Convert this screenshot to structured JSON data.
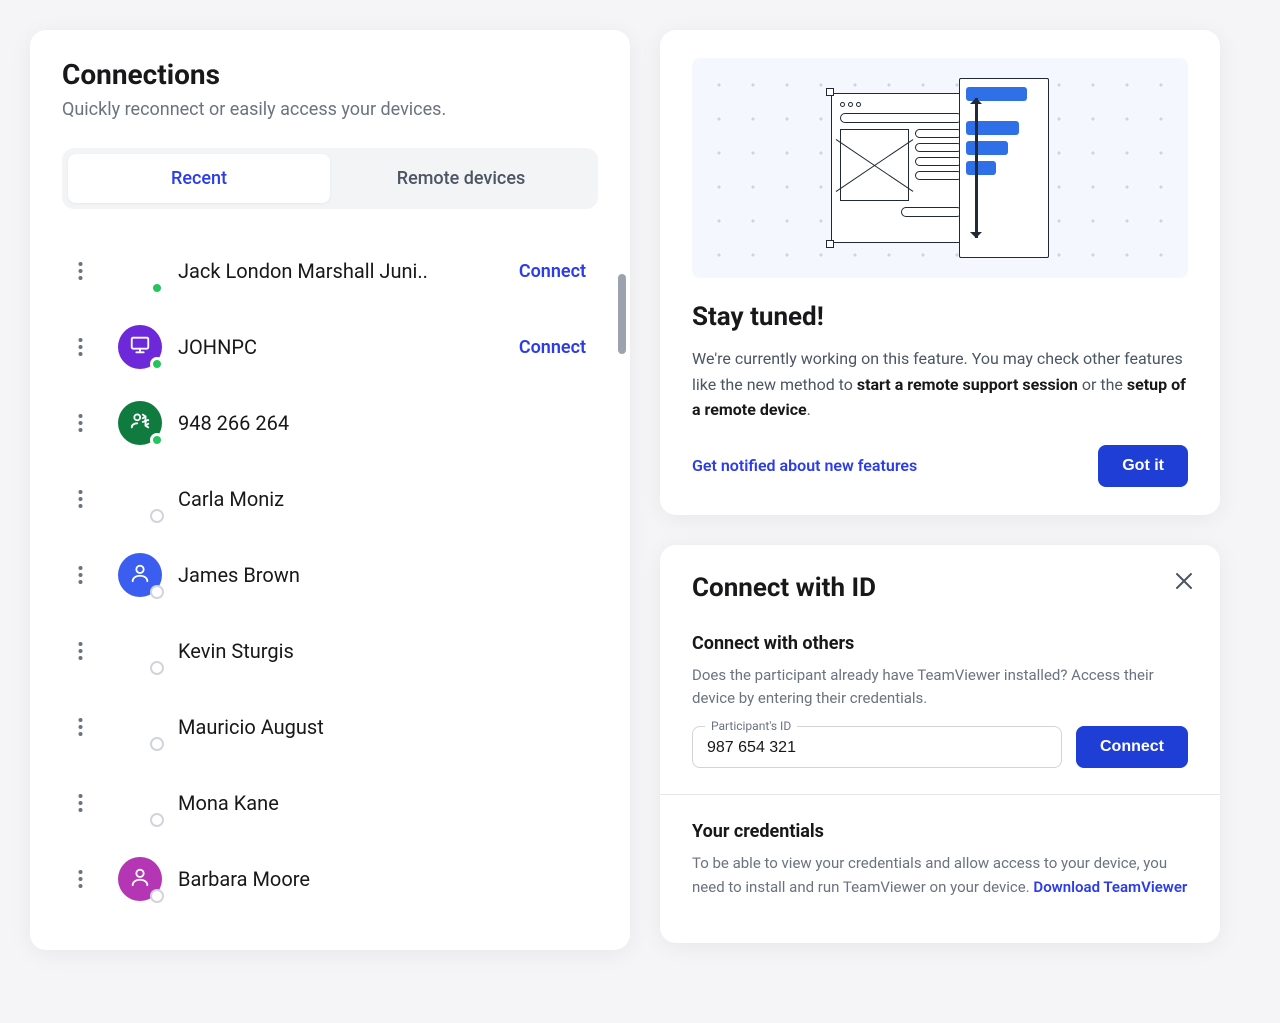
{
  "connections": {
    "title": "Connections",
    "subtitle": "Quickly reconnect or easily access your devices.",
    "tabs": {
      "recent": "Recent",
      "remote": "Remote devices"
    },
    "connect_label": "Connect",
    "items": [
      {
        "name": "Jack London Marshall Juni..",
        "avatar": "none",
        "status": "online",
        "show_connect": true
      },
      {
        "name": "JOHNPC",
        "avatar": "purple",
        "icon": "monitor",
        "status": "online",
        "show_connect": true
      },
      {
        "name": "948 266 264",
        "avatar": "green",
        "icon": "user-swap",
        "status": "online",
        "show_connect": false
      },
      {
        "name": "Carla Moniz",
        "avatar": "none",
        "status": "offline",
        "show_connect": false
      },
      {
        "name": "James Brown",
        "avatar": "blue",
        "icon": "user",
        "status": "offline",
        "show_connect": false
      },
      {
        "name": "Kevin Sturgis",
        "avatar": "none",
        "status": "offline",
        "show_connect": false
      },
      {
        "name": "Mauricio August",
        "avatar": "none",
        "status": "offline",
        "show_connect": false
      },
      {
        "name": "Mona Kane",
        "avatar": "none",
        "status": "offline",
        "show_connect": false
      },
      {
        "name": "Barbara Moore",
        "avatar": "magenta",
        "icon": "user",
        "status": "offline",
        "show_connect": false
      }
    ]
  },
  "tuned": {
    "title": "Stay tuned!",
    "body_pre": "We're currently working on this feature. You may check other features like the new method to ",
    "body_strong1": "start a remote support session",
    "body_mid": " or the ",
    "body_strong2": "setup of a remote device",
    "body_post": ".",
    "link": "Get notified about new features",
    "button": "Got it"
  },
  "connect_id": {
    "title": "Connect with ID",
    "section1_title": "Connect with others",
    "section1_body": "Does the participant already have TeamViewer installed? Access their device by entering their credentials.",
    "input_label": "Participant's ID",
    "input_value": "987 654 321",
    "button": "Connect",
    "section2_title": "Your credentials",
    "section2_body": "To be able to view your credentials and allow access to your device, you need to install and run TeamViewer on your device. ",
    "download_link": "Download TeamViewer"
  }
}
